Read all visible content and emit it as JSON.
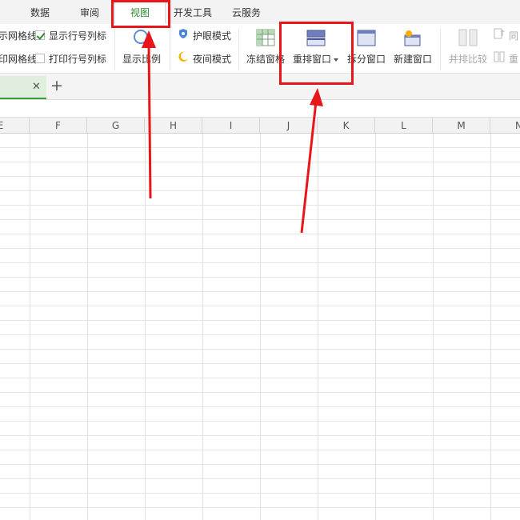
{
  "menu": {
    "tabs": [
      {
        "label": "数据"
      },
      {
        "label": "审阅"
      },
      {
        "label": "视图",
        "active": true
      },
      {
        "label": "开发工具"
      },
      {
        "label": "云服务"
      }
    ]
  },
  "ribbon": {
    "row1_left_label": "示网格线",
    "row2_left_label": "印网格线",
    "show_rowcol_label": "显示行号列标",
    "show_rowcol_checked": true,
    "print_rowcol_label": "打印行号列标",
    "print_rowcol_checked": false,
    "zoom_label": "显示比例",
    "eye_mode_label": "护眼模式",
    "night_mode_label": "夜间模式",
    "freeze_label": "冻结窗格",
    "arrange_label": "重排窗口",
    "split_label": "拆分窗口",
    "new_window_label": "新建窗口",
    "compare_label": "并排比较",
    "sync_label": "同",
    "reset_label": "重"
  },
  "columns": [
    "E",
    "F",
    "G",
    "H",
    "I",
    "J",
    "K",
    "L",
    "M",
    "N"
  ],
  "colors": {
    "accent_green": "#2f8a2f",
    "annotation_red": "#e8161b",
    "active_sheet_tab": "#dfeedd"
  },
  "icons": [
    "zoom-icon",
    "eye-mode-icon",
    "night-mode-icon",
    "freeze-panes-icon",
    "arrange-window-icon",
    "split-window-icon",
    "new-window-icon",
    "compare-icon"
  ]
}
